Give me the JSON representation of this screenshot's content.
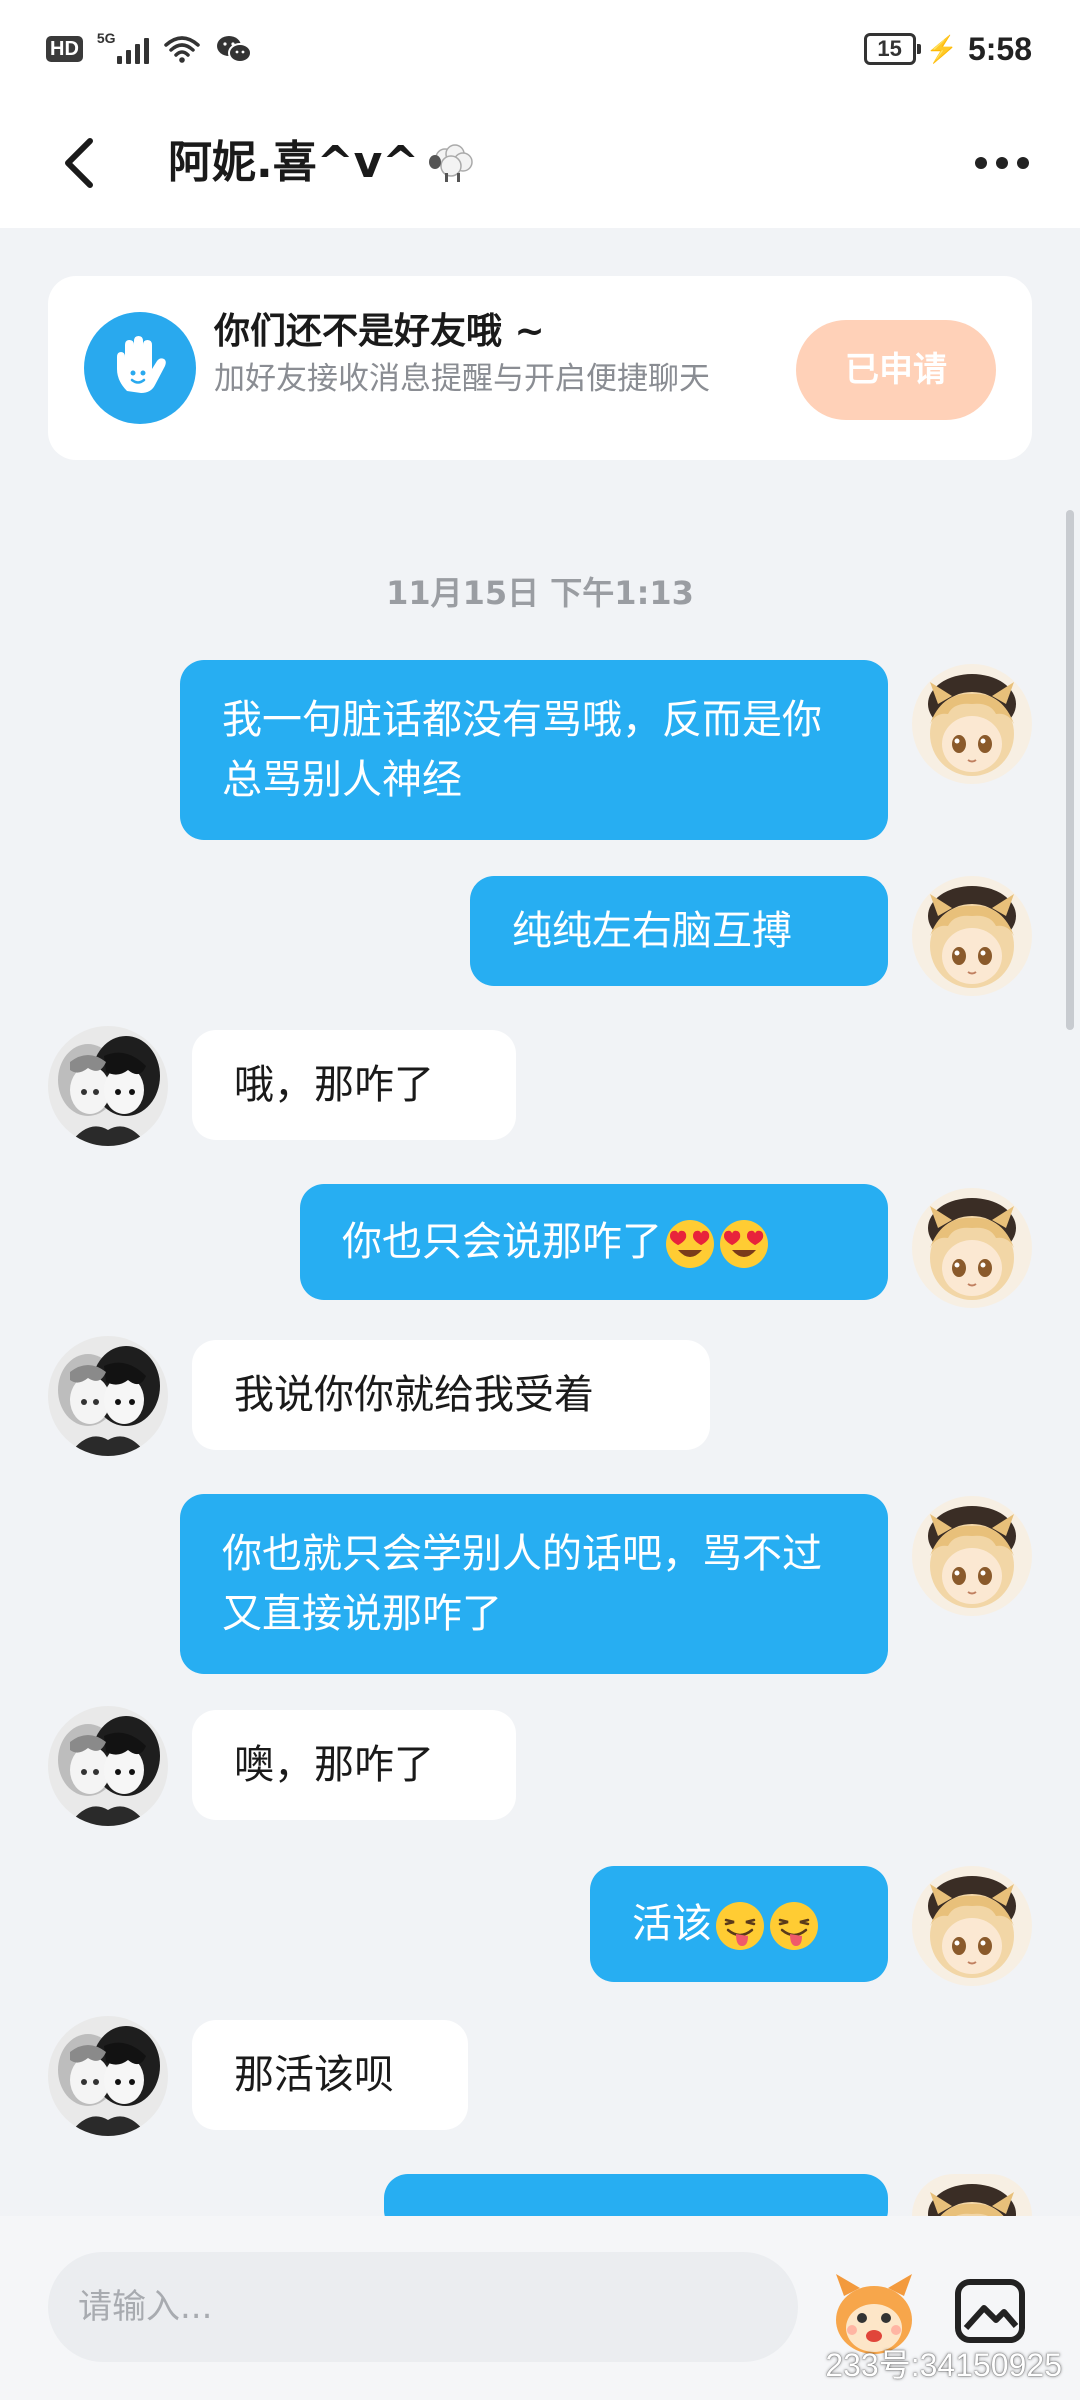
{
  "status_bar": {
    "hd": "HD",
    "network": "5G",
    "battery": "15",
    "time": "5:58"
  },
  "header": {
    "title": "阿妮.喜^v^",
    "title_icon": "sheep-icon",
    "back_icon": "chevron-left-icon",
    "more_icon": "more-dots-icon"
  },
  "friend_banner": {
    "title": "你们还不是好友哦 ~",
    "subtitle": "加好友接收消息提醒与开启便捷聊天",
    "button": "已申请",
    "icon": "hand-icon",
    "button_color": "#ffd1b8"
  },
  "timestamp": "11月15日 下午1:13",
  "messages": [
    {
      "side": "out",
      "text": "我一句脏话都没有骂哦，反而是你总骂别人神经"
    },
    {
      "side": "out",
      "text": "纯纯左右脑互搏"
    },
    {
      "side": "in",
      "text": "哦，那咋了"
    },
    {
      "side": "out",
      "text": "你也只会说那咋了",
      "emoji": [
        "heart-eyes-emoji",
        "heart-eyes-emoji"
      ]
    },
    {
      "side": "in",
      "text": "我说你你就给我受着"
    },
    {
      "side": "out",
      "text": "你也就只会学别人的话吧，骂不过又直接说那咋了"
    },
    {
      "side": "in",
      "text": "噢，那咋了"
    },
    {
      "side": "out",
      "text": "活该",
      "emoji": [
        "tongue-wink-emoji",
        "tongue-wink-emoji"
      ]
    },
    {
      "side": "in",
      "text": "那活该呗"
    }
  ],
  "input_bar": {
    "placeholder": "请输入...",
    "mascot_icon": "mascot-icon",
    "gallery_icon": "gallery-icon"
  },
  "watermark": "233号:34150925",
  "colors": {
    "outgoing_bubble": "#27aef2",
    "incoming_bubble": "#ffffff",
    "background": "#f1f3f6",
    "accent": "#29a9ee"
  }
}
